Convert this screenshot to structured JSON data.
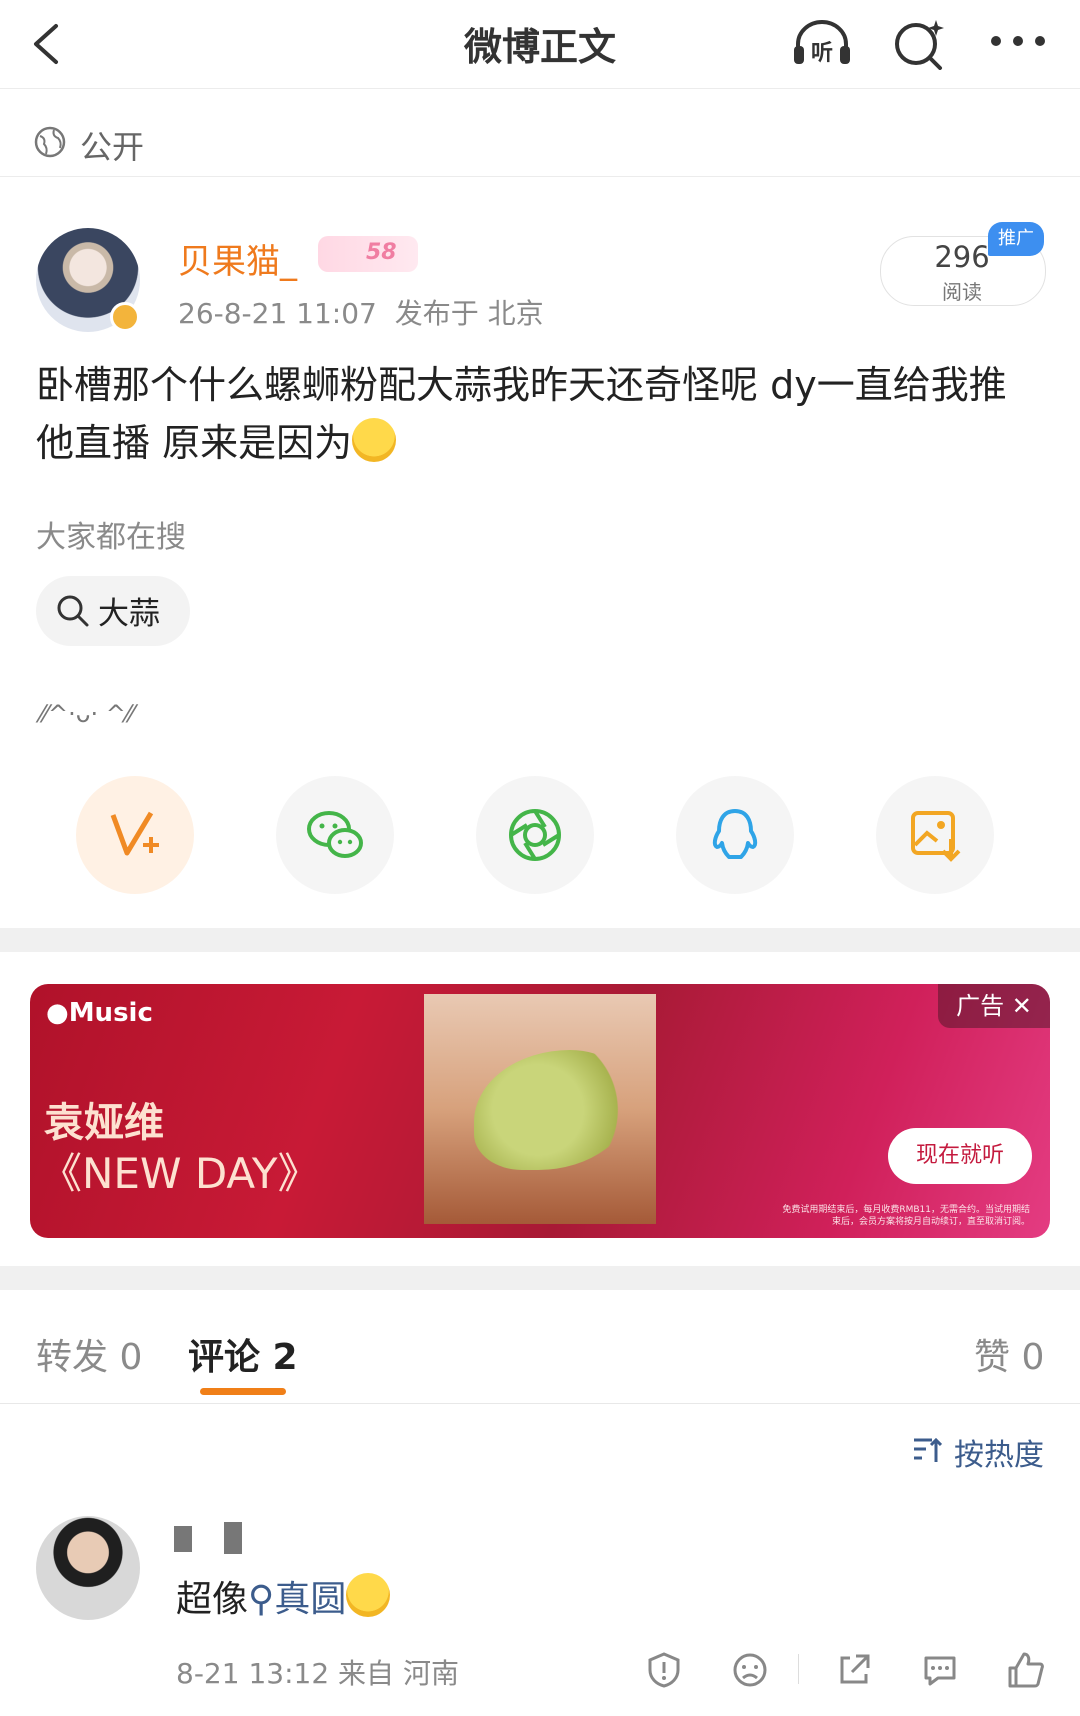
{
  "nav": {
    "title": "微博正文",
    "listen_label": "听"
  },
  "visibility": {
    "label": "公开"
  },
  "post": {
    "username": "贝果猫_",
    "level": "58",
    "timestamp": "26-8-21 11:07",
    "location": "发布于 北京",
    "read_count": "296",
    "read_label": "阅读",
    "promo_tag": "推广",
    "text": "卧槽那个什么螺蛳粉配大蒜我昨天还奇怪呢 dy一直给我推他直播 原来是因为"
  },
  "search": {
    "hint": "大家都在搜",
    "chip": "大蒜"
  },
  "kaomoji": "⁄⁄^·ᴗ· ^⁄⁄",
  "share_buttons": [
    "vplus-icon",
    "wechat-icon",
    "moments-icon",
    "qq-icon",
    "save-image-icon"
  ],
  "ad": {
    "brand": "Music",
    "title_line1": "袁娅维",
    "title_line2": "《NEW DAY》",
    "tag": "广告 ✕",
    "cta": "现在就听",
    "fine_print": "免费试用期结束后，每月收费RMB11，无需合约。当试用期结束后，会员方案将按月自动续订，直至取消订阅。"
  },
  "tabs": {
    "repost": "转发 0",
    "comment": "评论 2",
    "like": "赞 0"
  },
  "sort": {
    "label": "按热度"
  },
  "comment": {
    "text": "超像",
    "link": "真圆",
    "time": "8-21 13:12",
    "location": "来自 河南"
  },
  "colors": {
    "accent": "#ef7a1d",
    "link": "#3c5c8c",
    "tab_underline": "#f07f18"
  }
}
